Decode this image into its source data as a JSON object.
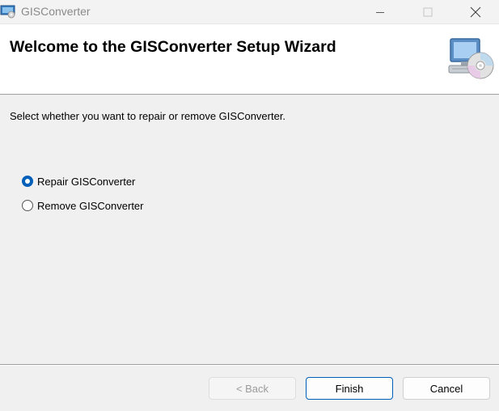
{
  "window": {
    "title": "GISConverter",
    "icons": [
      "app-icon",
      "minimize-icon",
      "maximize-icon",
      "close-icon"
    ]
  },
  "header": {
    "title": "Welcome to the GISConverter Setup Wizard",
    "icon": "computer-cd-icon"
  },
  "main": {
    "prompt": "Select whether you want to repair or remove GISConverter.",
    "options": [
      {
        "label": "Repair GISConverter",
        "selected": true
      },
      {
        "label": "Remove GISConverter",
        "selected": false
      }
    ]
  },
  "footer": {
    "back_label": "< Back",
    "finish_label": "Finish",
    "cancel_label": "Cancel"
  },
  "colors": {
    "accent": "#005fb8",
    "background": "#f0f0f0",
    "header_background": "#ffffff"
  }
}
